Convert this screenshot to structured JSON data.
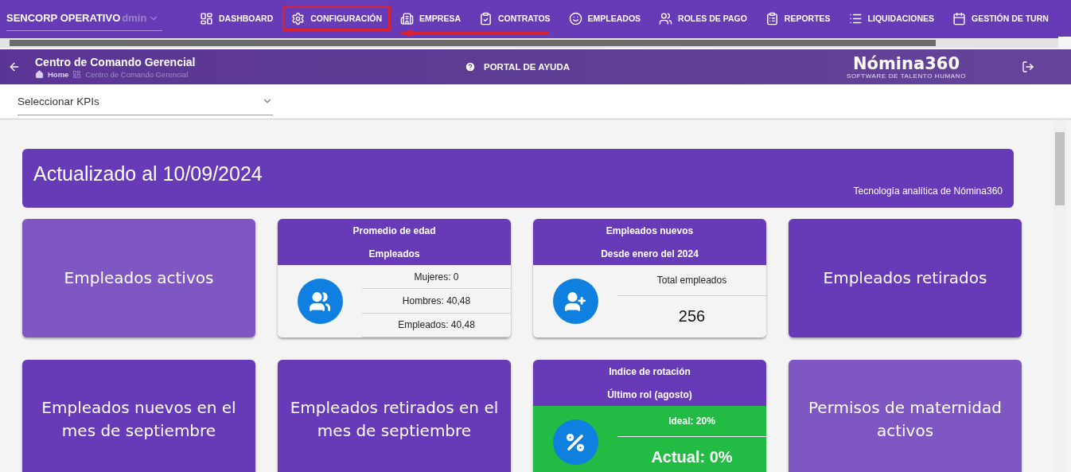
{
  "nav": {
    "company": "SENCORP OPERATIVO",
    "company_label": "dmin",
    "items": [
      {
        "label": "DASHBOARD",
        "highlighted": false
      },
      {
        "label": "CONFIGURACIÓN",
        "highlighted": true
      },
      {
        "label": "EMPRESA",
        "highlighted": false
      },
      {
        "label": "CONTRATOS",
        "highlighted": false
      },
      {
        "label": "EMPLEADOS",
        "highlighted": false
      },
      {
        "label": "ROLES DE PAGO",
        "highlighted": false
      },
      {
        "label": "REPORTES",
        "highlighted": false
      },
      {
        "label": "LIQUIDACIONES",
        "highlighted": false
      },
      {
        "label": "GESTIÓN DE TURN",
        "highlighted": false
      }
    ]
  },
  "header": {
    "title": "Centro de Comando Gerencial",
    "breadcrumb": [
      "Home",
      "Centro de Comando Gerencial"
    ],
    "help": "PORTAL DE AYUDA",
    "logo": "Nómina360",
    "logo_tagline": "SOFTWARE DE TALENTO HUMANO"
  },
  "kpi_select": {
    "placeholder": "Seleccionar KPIs"
  },
  "banner": {
    "title": "Actualizado al 10/09/2024",
    "subtitle": "Tecnología analítica de Nómina360"
  },
  "cards": [
    {
      "kind": "big",
      "text": "Empleados activos",
      "color": "#7e57c2"
    },
    {
      "kind": "stat",
      "title": [
        "Promedio de edad",
        "Empleados"
      ],
      "lines": [
        "Mujeres: 0",
        "Hombres: 40,48",
        "Empleados: 40,48"
      ]
    },
    {
      "kind": "total",
      "title": [
        "Empleados nuevos",
        "Desde enero del 2024"
      ],
      "lines": [
        "Total empleados"
      ],
      "value": "256"
    },
    {
      "kind": "big",
      "text": "Empleados retirados",
      "color": "#673ab7"
    },
    {
      "kind": "big",
      "text": "Empleados nuevos en el mes de septiembre",
      "color": "#673ab7"
    },
    {
      "kind": "big",
      "text": "Empleados retirados en el mes de septiembre",
      "color": "#673ab7"
    },
    {
      "kind": "rotation",
      "title": [
        "Indice de rotación",
        "Último rol (agosto)"
      ],
      "lines": [
        "Ideal: 20%"
      ],
      "value": "Actual: 0%"
    },
    {
      "kind": "big",
      "text": "Permisos de maternidad activos",
      "color": "#7e57c2"
    }
  ]
}
